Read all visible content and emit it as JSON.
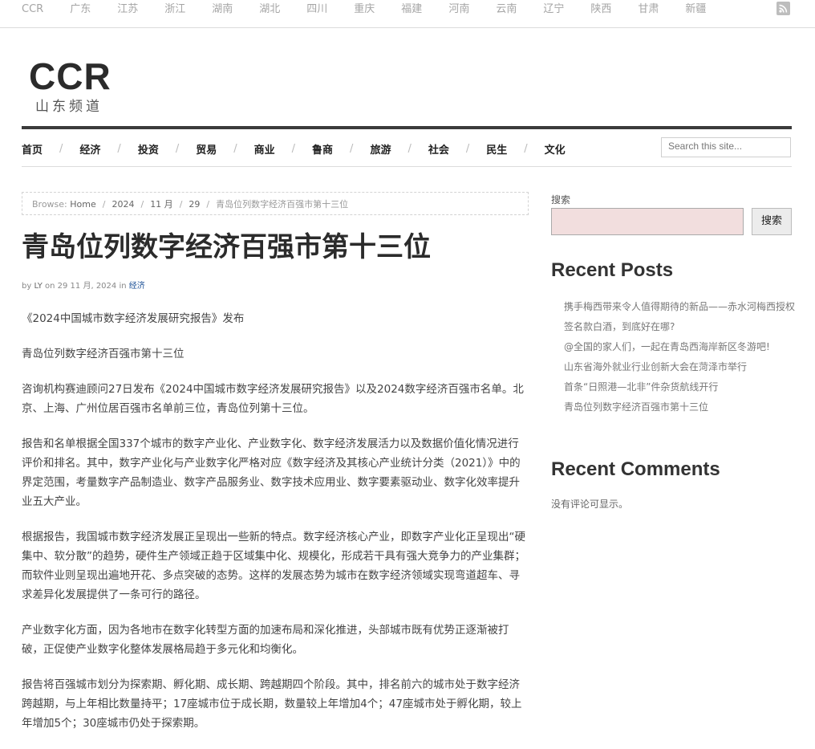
{
  "topbar": {
    "cities": [
      "CCR",
      "广东",
      "江苏",
      "浙江",
      "湖南",
      "湖北",
      "四川",
      "重庆",
      "福建",
      "河南",
      "云南",
      "辽宁",
      "陕西",
      "甘肃",
      "新疆"
    ],
    "rss_icon": "rss-icon"
  },
  "logo": {
    "title": "CCR",
    "subtitle": "山东频道"
  },
  "nav": {
    "items": [
      "首页",
      "经济",
      "投资",
      "贸易",
      "商业",
      "鲁商",
      "旅游",
      "社会",
      "民生",
      "文化"
    ],
    "search_placeholder": "Search this site..."
  },
  "breadcrumb": {
    "prefix": "Browse:",
    "home": "Home",
    "year": "2024",
    "month": "11 月",
    "day": "29",
    "current": "青岛位列数字经济百强市第十三位"
  },
  "article": {
    "title": "青岛位列数字经济百强市第十三位",
    "by": "by",
    "author": "LY",
    "on": "on",
    "date": "29 11 月, 2024",
    "in": "in",
    "category": "经济",
    "paragraphs": [
      "《2024中国城市数字经济发展研究报告》发布",
      "青岛位列数字经济百强市第十三位",
      "咨询机构赛迪顾问27日发布《2024中国城市数字经济发展研究报告》以及2024数字经济百强市名单。北京、上海、广州位居百强市名单前三位，青岛位列第十三位。",
      "报告和名单根据全国337个城市的数字产业化、产业数字化、数字经济发展活力以及数据价值化情况进行评价和排名。其中，数字产业化与产业数字化严格对应《数字经济及其核心产业统计分类（2021）》中的界定范围，考量数字产品制造业、数字产品服务业、数字技术应用业、数字要素驱动业、数字化效率提升业五大产业。",
      "根据报告，我国城市数字经济发展正呈现出一些新的特点。数字经济核心产业，即数字产业化正呈现出“硬集中、软分散”的趋势，硬件生产领域正趋于区域集中化、规模化，形成若干具有强大竞争力的产业集群；而软件业则呈现出遍地开花、多点突破的态势。这样的发展态势为城市在数字经济领域实现弯道超车、寻求差异化发展提供了一条可行的路径。",
      "产业数字化方面，因为各地市在数字化转型方面的加速布局和深化推进，头部城市既有优势正逐渐被打破，正促使产业数字化整体发展格局趋于多元化和均衡化。",
      "报告将百强城市划分为探索期、孵化期、成长期、跨越期四个阶段。其中，排名前六的城市处于数字经济跨越期，与上年相比数量持平；17座城市位于成长期，数量较上年增加4个；47座城市处于孵化期，较上年增加5个；30座城市仍处于探索期。"
    ]
  },
  "sidebar": {
    "search_label": "搜索",
    "search_button": "搜索",
    "recent_posts_title": "Recent Posts",
    "recent_posts": [
      "携手梅西带来令人值得期待的新品——赤水河梅西授权签名款白酒，到底好在哪?",
      "@全国的家人们，一起在青岛西海岸新区冬游吧!",
      "山东省海外就业行业创新大会在菏泽市举行",
      "首条“日照港—北非”件杂货航线开行",
      "青岛位列数字经济百强市第十三位"
    ],
    "recent_comments_title": "Recent Comments",
    "no_comments": "没有评论可显示。"
  }
}
